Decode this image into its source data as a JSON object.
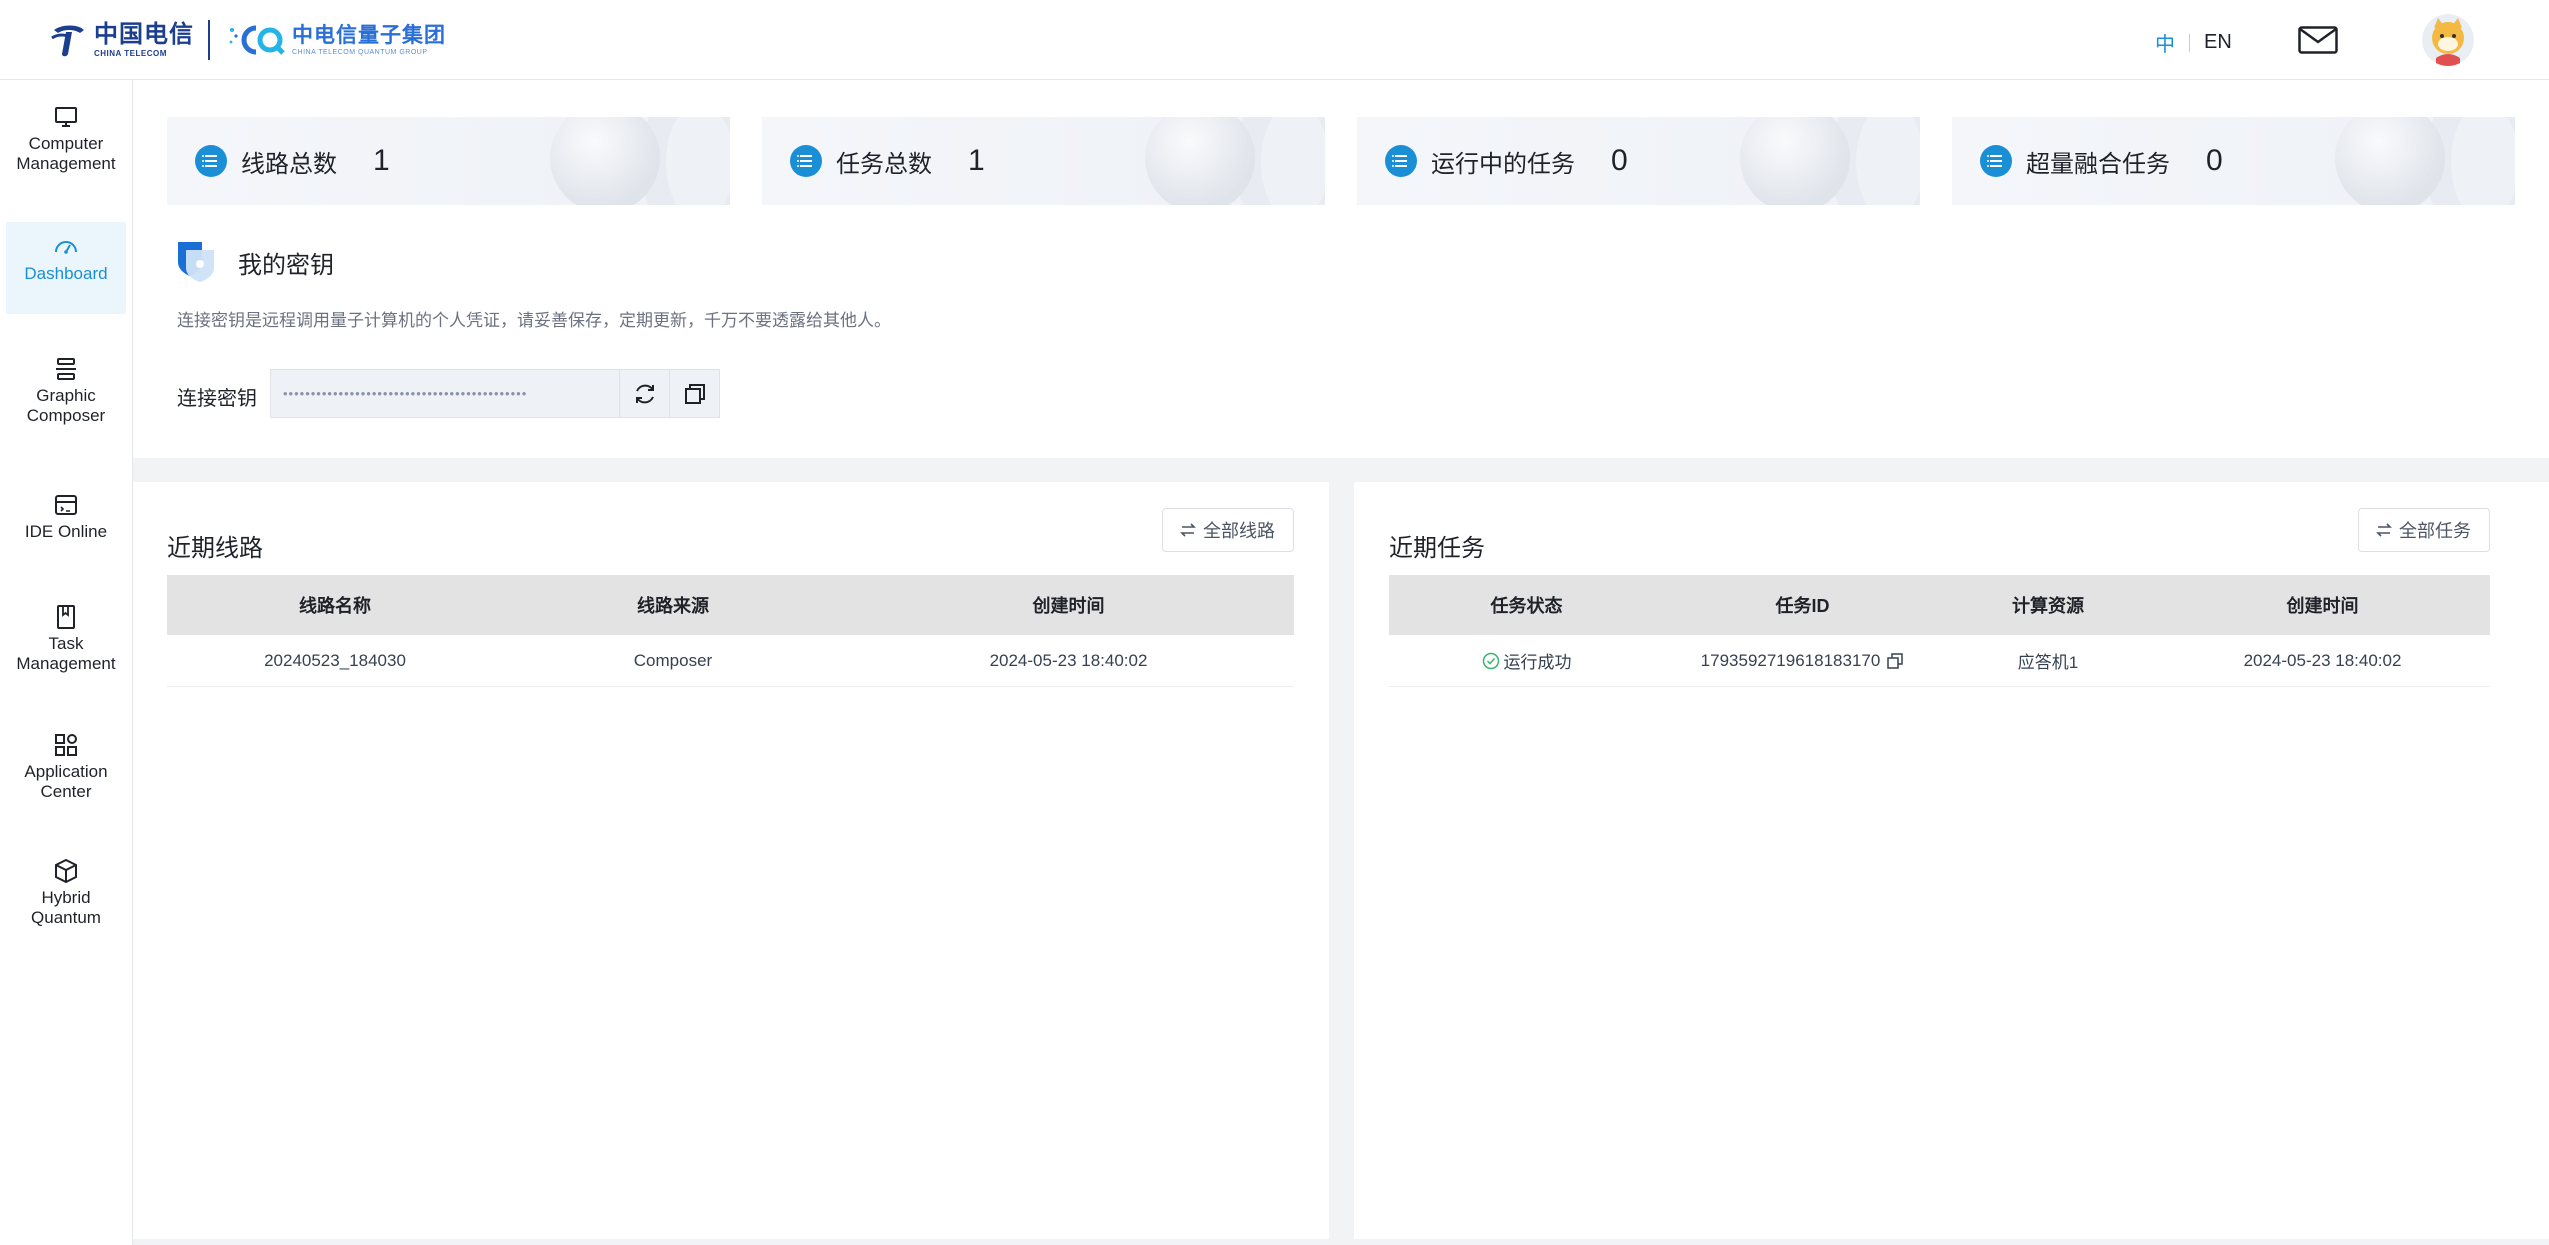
{
  "header": {
    "brand_ct_cn": "中国电信",
    "brand_ct_en": "CHINA TELECOM",
    "brand_cq_cn": "中电信量子集团",
    "brand_cq_en": "CHINA TELECOM QUANTUM GROUP",
    "lang_zh": "中",
    "lang_en": "EN",
    "mail_icon": "mail-icon",
    "avatar_icon": "avatar-icon"
  },
  "sidebar": {
    "items": [
      {
        "label_line1": "Computer",
        "label_line2": "Management",
        "icon": "monitor-icon"
      },
      {
        "label_line1": "Dashboard",
        "label_line2": "",
        "icon": "dashboard-gauge-icon"
      },
      {
        "label_line1": "Graphic",
        "label_line2": "Composer",
        "icon": "composer-icon"
      },
      {
        "label_line1": "IDE Online",
        "label_line2": "",
        "icon": "ide-window-icon"
      },
      {
        "label_line1": "Task",
        "label_line2": "Management",
        "icon": "task-book-icon"
      },
      {
        "label_line1": "Application",
        "label_line2": "Center",
        "icon": "app-grid-icon"
      },
      {
        "label_line1": "Hybrid",
        "label_line2": "Quantum",
        "icon": "cube-icon"
      }
    ],
    "active_index": 1
  },
  "stats": [
    {
      "label": "线路总数",
      "value": "1",
      "icon": "list-icon"
    },
    {
      "label": "任务总数",
      "value": "1",
      "icon": "list-icon"
    },
    {
      "label": "运行中的任务",
      "value": "0",
      "icon": "list-icon"
    },
    {
      "label": "超量融合任务",
      "value": "0",
      "icon": "list-icon"
    }
  ],
  "key": {
    "title": "我的密钥",
    "description": "连接密钥是远程调用量子计算机的个人凭证，请妥善保存，定期更新，千万不要透露给其他人。",
    "label": "连接密钥",
    "masked_value": "••••••••••••••••••••••••••••••••••••••••••••",
    "refresh_icon": "refresh-icon",
    "copy_icon": "copy-icon"
  },
  "circuits": {
    "title": "近期线路",
    "button": "全部线路",
    "columns": [
      "线路名称",
      "线路来源",
      "创建时间"
    ],
    "rows": [
      {
        "name": "20240523_184030",
        "source": "Composer",
        "created": "2024-05-23 18:40:02"
      }
    ]
  },
  "tasks": {
    "title": "近期任务",
    "button": "全部任务",
    "columns": [
      "任务状态",
      "任务ID",
      "计算资源",
      "创建时间"
    ],
    "rows": [
      {
        "status": "运行成功",
        "task_id": "1793592719618183170",
        "resource": "应答机1",
        "created": "2024-05-23 18:40:02"
      }
    ]
  },
  "colors": {
    "accent": "#1a8fd6",
    "success": "#3cb371",
    "brand_blue": "#1b3e8f"
  }
}
